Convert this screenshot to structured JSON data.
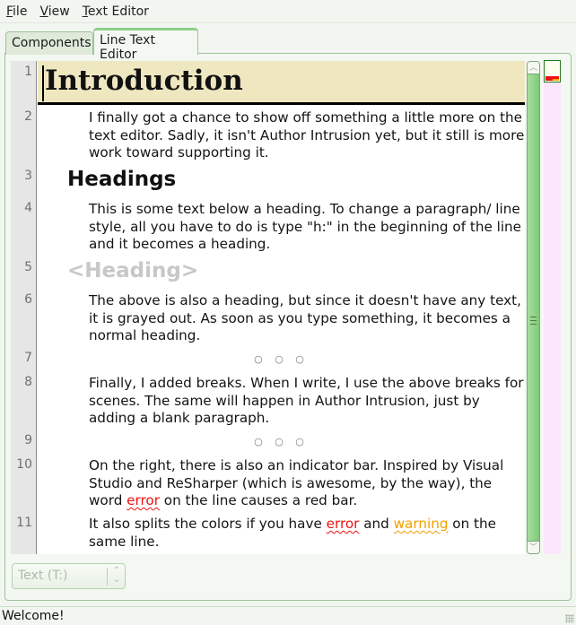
{
  "menubar": {
    "items": [
      {
        "label": "File",
        "mnemonic": "F",
        "rest": "ile"
      },
      {
        "label": "View",
        "mnemonic": "V",
        "rest": "iew"
      },
      {
        "label": "Text Editor",
        "mnemonic": "T",
        "rest": "ext Editor"
      }
    ]
  },
  "tabs": [
    {
      "label": "Components",
      "active": false
    },
    {
      "label": "Line Text Editor",
      "active": true
    }
  ],
  "editor": {
    "lines": [
      {
        "number": "1",
        "style": "heading1",
        "text": "Introduction"
      },
      {
        "number": "2",
        "style": "paragraph",
        "text": "I finally got a chance to show off something a little more on the text editor. Sadly, it isn't Author Intrusion yet, but it still is more work toward supporting it."
      },
      {
        "number": "3",
        "style": "heading",
        "text": "Headings"
      },
      {
        "number": "4",
        "style": "paragraph",
        "text": "This is some text below a heading. To change a paragraph/ line style, all you have to do is type \"h:\" in the beginning of the line and it becomes a heading."
      },
      {
        "number": "5",
        "style": "heading-empty",
        "text": "<Heading>"
      },
      {
        "number": "6",
        "style": "paragraph",
        "text": "The above is also a heading, but since it doesn't have any text, it is grayed out. As soon as you type something, it becomes a normal heading."
      },
      {
        "number": "7",
        "style": "break",
        "text": "○ ○ ○"
      },
      {
        "number": "8",
        "style": "paragraph",
        "text": "Finally, I added breaks. When I write, I use the above breaks for scenes. The same will happen in Author Intrusion, just by adding a blank paragraph."
      },
      {
        "number": "9",
        "style": "break",
        "text": "○ ○ ○"
      },
      {
        "number": "10",
        "style": "paragraph",
        "text_before": "On the right, there is also an indicator bar. Inspired by Visual Studio and ReSharper (which is awesome, by the way), the word ",
        "error_word": "error",
        "text_after": " on the line causes a red bar."
      },
      {
        "number": "11",
        "style": "paragraph",
        "text_before": "It also splits the colors if you have ",
        "error_word": "error",
        "text_middle": " and ",
        "warning_word": "warning",
        "text_after": " on the same line."
      }
    ]
  },
  "scrollbar": {
    "up_icon": "▲",
    "down_icon": "▼"
  },
  "indicator_bar": {
    "error_color": "#ee1111",
    "warning_color": "#f6a400",
    "background_color": "#fbe6fb"
  },
  "style_combo": {
    "value": "Text (T:)",
    "icon": "⇕"
  },
  "status": {
    "text": "Welcome!"
  }
}
